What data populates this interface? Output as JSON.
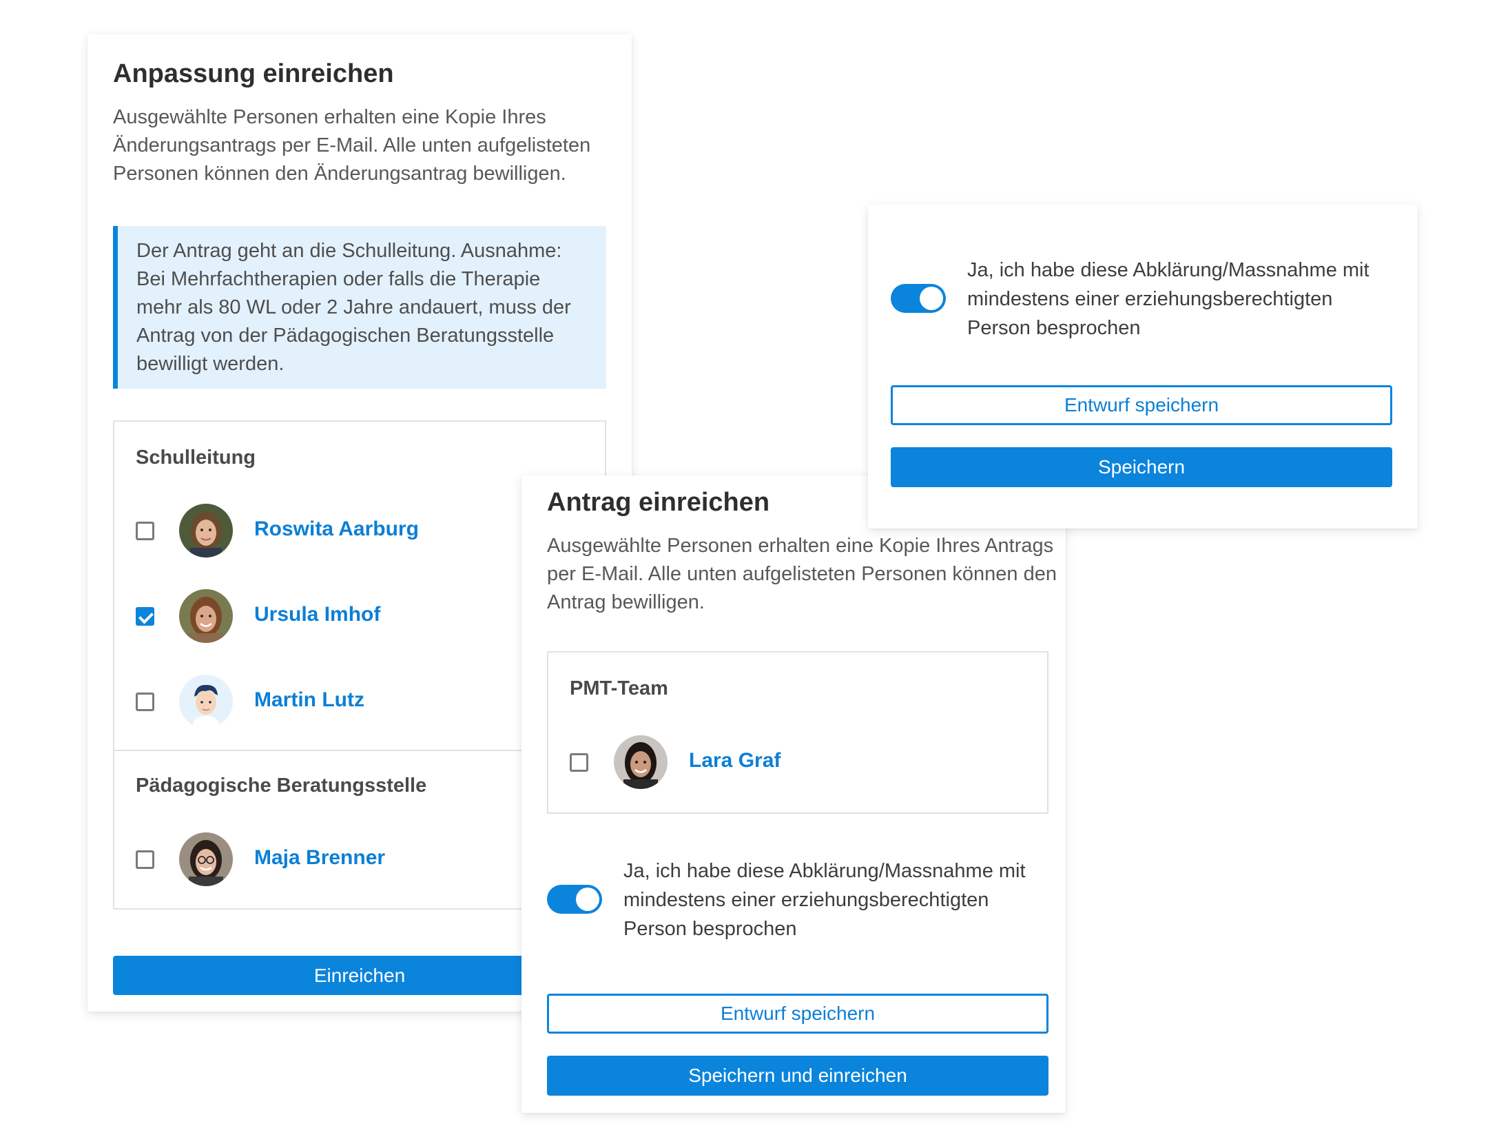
{
  "anpassung": {
    "title": "Anpassung einreichen",
    "description": "Ausgewählte Personen erhalten eine Kopie Ihres Änderungsantrags per E-Mail. Alle unten aufgelisteten Personen können den Änderungsantrag bewilligen.",
    "info": "Der Antrag geht an die Schulleitung. Ausnahme: Bei Mehrfachtherapien oder falls die Therapie mehr als 80 WL oder 2 Jahre andauert, muss der Antrag von der Pädagogischen Beratungsstelle bewilligt werden.",
    "groups": [
      {
        "label": "Schulleitung",
        "people": [
          {
            "name": "Roswita Aarburg",
            "checked": false,
            "avatar": "photo-woman-icon"
          },
          {
            "name": "Ursula Imhof",
            "checked": true,
            "avatar": "photo-woman-icon"
          },
          {
            "name": "Martin Lutz",
            "checked": false,
            "avatar": "cartoon-man-icon"
          }
        ]
      },
      {
        "label": "Pädagogische Beratungsstelle",
        "people": [
          {
            "name": "Maja Brenner",
            "checked": false,
            "avatar": "photo-woman-glasses-icon"
          }
        ]
      }
    ],
    "submit_label": "Einreichen"
  },
  "antrag": {
    "title": "Antrag einreichen",
    "description": "Ausgewählte Personen erhalten eine Kopie Ihres Antrags per E-Mail. Alle unten aufgelisteten Personen können den Antrag bewilligen.",
    "group": {
      "label": "PMT-Team",
      "people": [
        {
          "name": "Lara Graf",
          "checked": false,
          "avatar": "photo-woman-icon"
        }
      ]
    },
    "toggle": {
      "on": true,
      "text": "Ja, ich habe diese Abklärung/Massnahme mit mindestens einer erziehungsberechtigten Person besprochen"
    },
    "draft_label": "Entwurf speichern",
    "save_submit_label": "Speichern und einreichen"
  },
  "top_card": {
    "toggle": {
      "on": true,
      "text": "Ja, ich habe diese Abklärung/Massnahme mit mindestens einer erziehungsberechtigten Person besprochen"
    },
    "draft_label": "Entwurf speichern",
    "save_label": "Speichern"
  },
  "colors": {
    "accent": "#0b84dc",
    "link": "#0b7fd6",
    "info_bg": "#e3f1fd"
  }
}
